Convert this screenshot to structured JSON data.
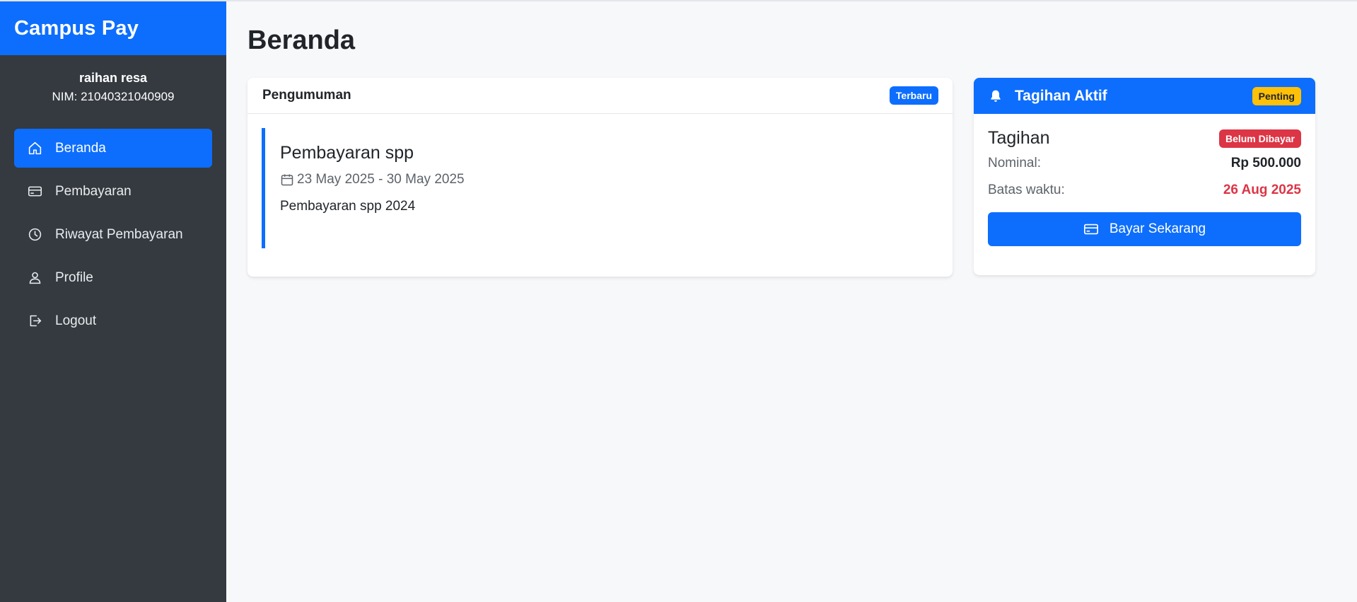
{
  "app": {
    "brand": "Campus Pay"
  },
  "user": {
    "name": "raihan resa",
    "nim": "NIM: 21040321040909"
  },
  "nav": {
    "items": [
      {
        "label": "Beranda",
        "icon": "home-icon",
        "active": true
      },
      {
        "label": "Pembayaran",
        "icon": "credit-card-icon",
        "active": false
      },
      {
        "label": "Riwayat Pembayaran",
        "icon": "clock-icon",
        "active": false
      },
      {
        "label": "Profile",
        "icon": "user-icon",
        "active": false
      },
      {
        "label": "Logout",
        "icon": "logout-icon",
        "active": false
      }
    ]
  },
  "page": {
    "title": "Beranda"
  },
  "announcements": {
    "header": "Pengumuman",
    "badge": "Terbaru",
    "item": {
      "title": "Pembayaran spp",
      "date": "23 May 2025 - 30 May 2025",
      "description": "Pembayaran spp 2024"
    }
  },
  "bill": {
    "header": "Tagihan Aktif",
    "badge": "Penting",
    "name": "Tagihan",
    "status": "Belum Dibayar",
    "nominal_label": "Nominal:",
    "nominal_value": "Rp 500.000",
    "deadline_label": "Batas waktu:",
    "deadline_value": "26 Aug 2025",
    "pay_button": "Bayar Sekarang"
  },
  "colors": {
    "primary": "#0d6efd",
    "sidebar": "#343a40",
    "danger": "#dc3545",
    "warning": "#ffc107",
    "background": "#f7f8fa"
  }
}
